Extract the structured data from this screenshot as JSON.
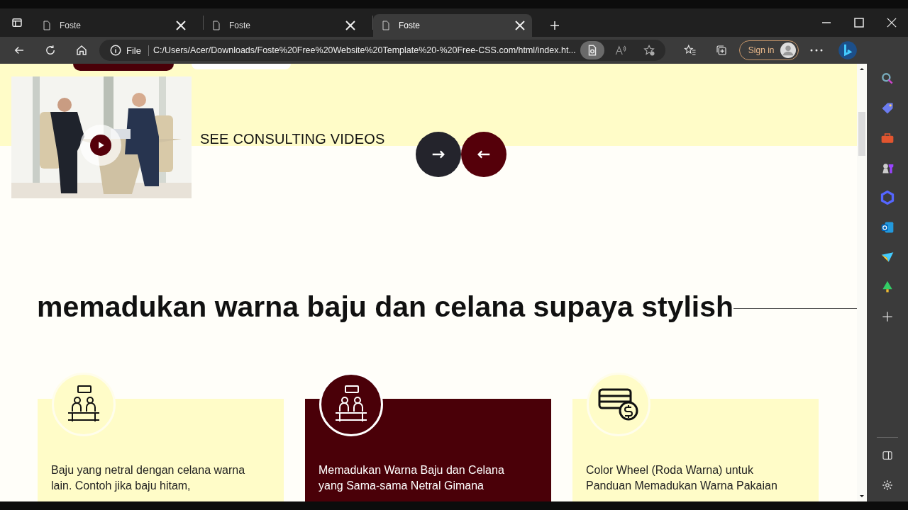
{
  "browser": {
    "tabs": [
      {
        "title": "Foste",
        "selected": false
      },
      {
        "title": "Foste",
        "selected": false
      },
      {
        "title": "Foste",
        "selected": true
      }
    ],
    "address": {
      "scheme": "File",
      "url": "C:/Users/Acer/Downloads/Foste%20Free%20Website%20Template%20-%20Free-CSS.com/html/index.ht..."
    },
    "sign_in": "Sign in"
  },
  "hero": {
    "video_label": "SEE CONSULTING VIDEOS"
  },
  "section": {
    "title": "memadukan warna baju dan celana supaya stylish"
  },
  "cards": [
    {
      "kind": "meeting",
      "highlighted": false,
      "text": "Baju yang netral dengan celana warna lain. Contoh jika baju hitam,"
    },
    {
      "kind": "meeting",
      "highlighted": true,
      "text": "Memadukan Warna Baju dan Celana yang Sama-sama Netral Gimana"
    },
    {
      "kind": "money",
      "highlighted": false,
      "text": "Color Wheel (Roda Warna) untuk Panduan Memadukan Warna Pakaian"
    }
  ]
}
